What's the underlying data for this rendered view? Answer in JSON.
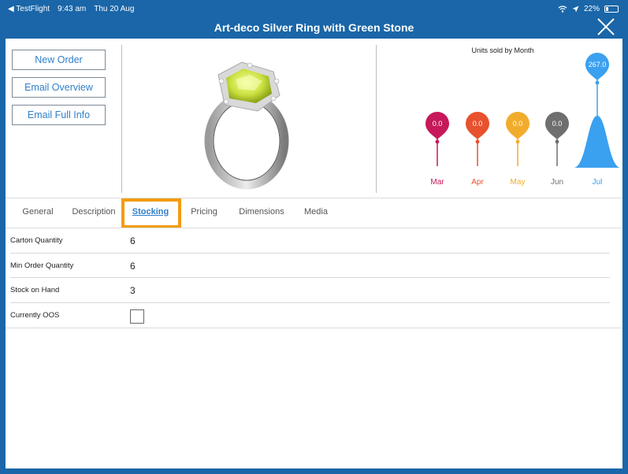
{
  "status_bar": {
    "back_app": "◀ TestFlight",
    "time": "9:43 am",
    "date": "Thu 20 Aug",
    "battery": "22%"
  },
  "header": {
    "title": "Art-deco Silver Ring with Green Stone"
  },
  "actions": {
    "new_order": "New Order",
    "email_overview": "Email Overview",
    "email_full_info": "Email Full Info"
  },
  "chart_data": {
    "type": "area",
    "title": "Units sold by Month",
    "categories": [
      "Mar",
      "Apr",
      "May",
      "Jun",
      "Jul"
    ],
    "values": [
      0.0,
      0.0,
      0.0,
      0.0,
      267.0
    ],
    "value_labels": [
      "0.0",
      "0.0",
      "0.0",
      "0.0",
      "267.0"
    ],
    "colors": [
      "#c6185a",
      "#e8512d",
      "#f2ac2c",
      "#6f6f6f",
      "#3aa0f0"
    ]
  },
  "tabs": [
    {
      "label": "General"
    },
    {
      "label": "Description"
    },
    {
      "label": "Stocking"
    },
    {
      "label": "Pricing"
    },
    {
      "label": "Dimensions"
    },
    {
      "label": "Media"
    }
  ],
  "stocking": {
    "carton_quantity": {
      "label": "Carton Quantity",
      "value": "6"
    },
    "min_order_quantity": {
      "label": "Min Order Quantity",
      "value": "6"
    },
    "stock_on_hand": {
      "label": "Stock on Hand",
      "value": "3"
    },
    "currently_oos": {
      "label": "Currently OOS",
      "checked": false
    }
  },
  "colors": {
    "frame": "#1a66a8",
    "accent": "#2f7fc9",
    "tab_highlight": "#f39c12"
  }
}
